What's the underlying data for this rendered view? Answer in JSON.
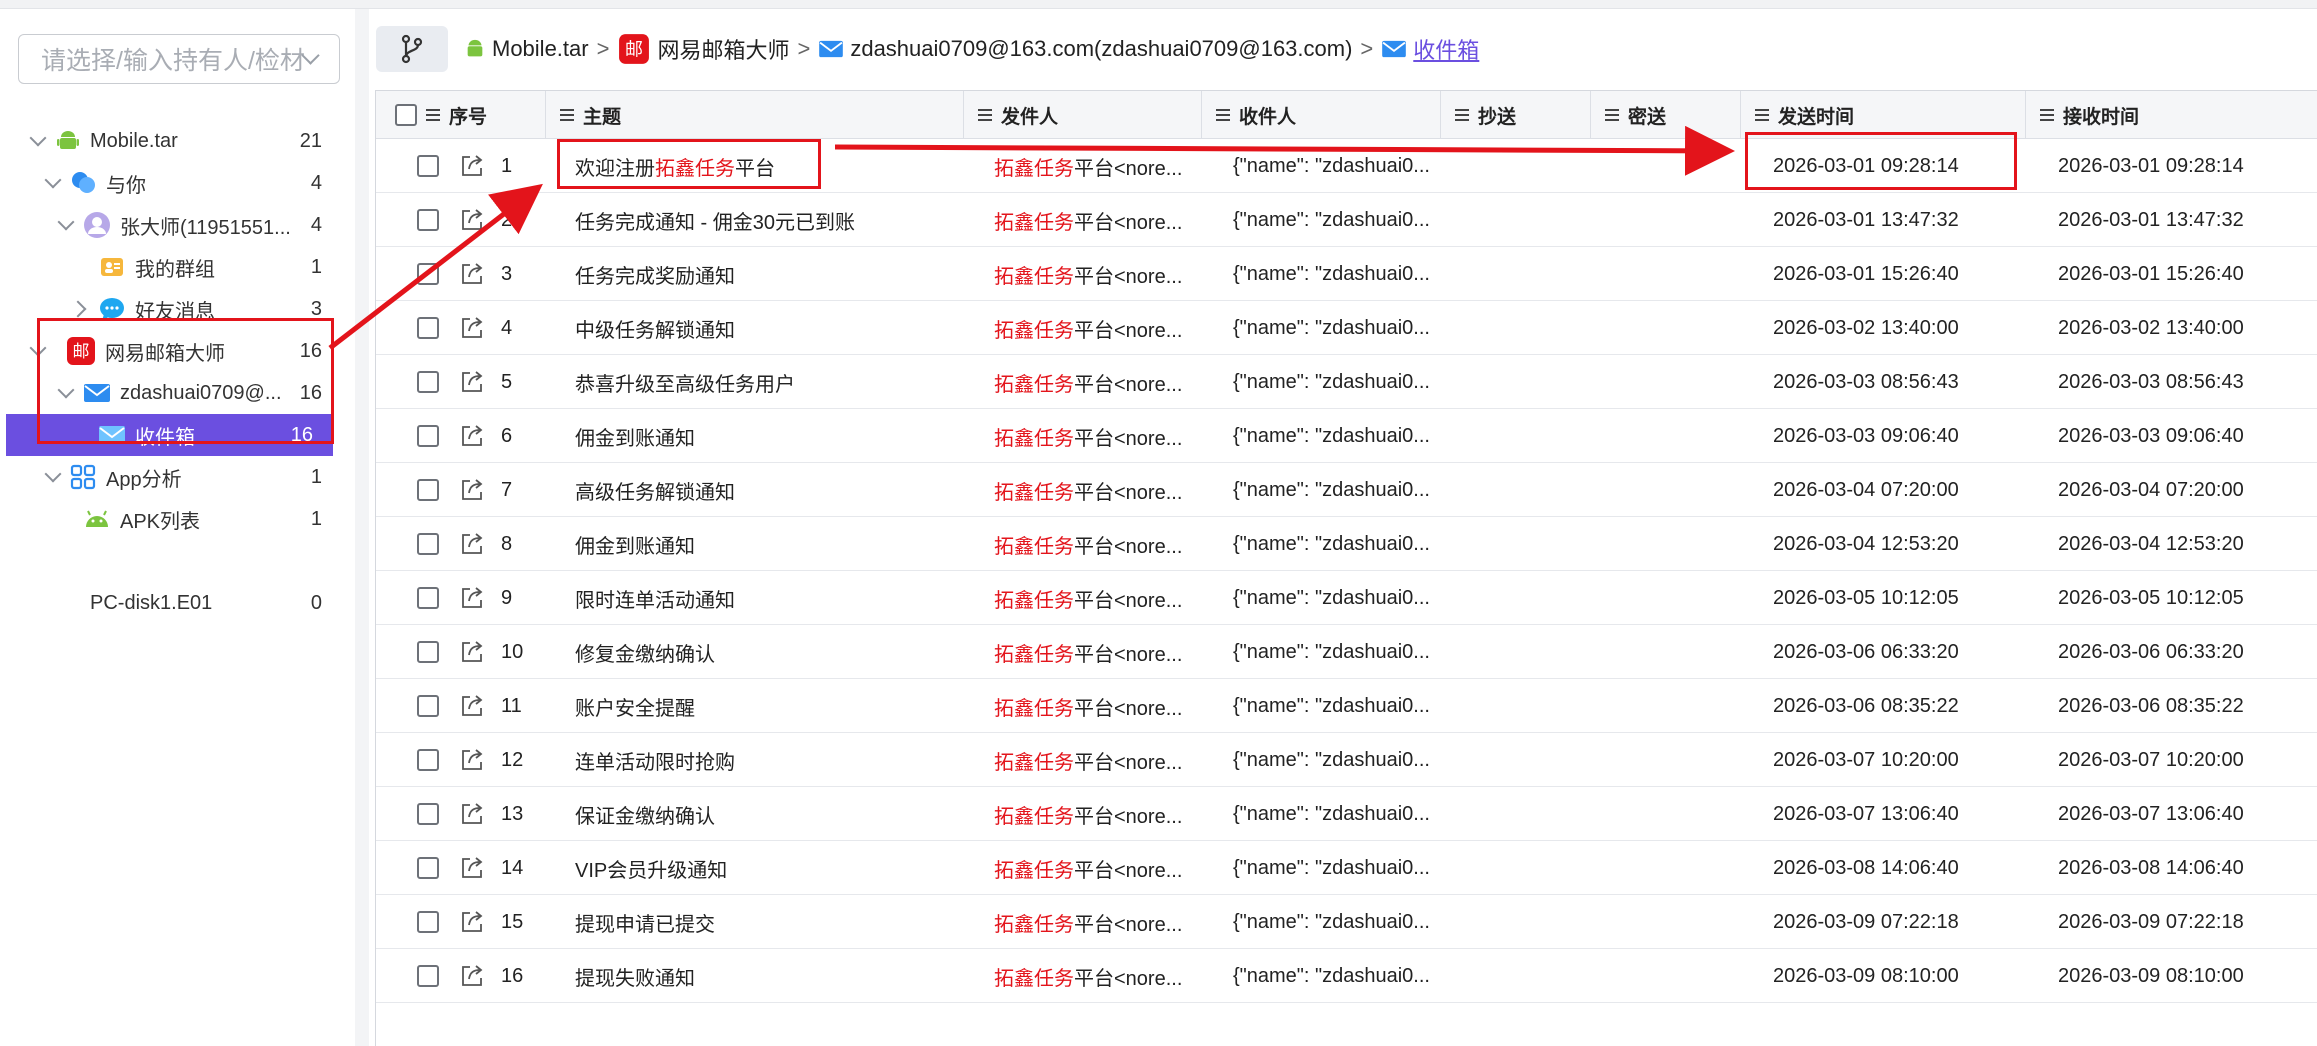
{
  "sidebar": {
    "holder_placeholder": "请选择/输入持有人/检材",
    "tree": [
      {
        "label": "Mobile.tar",
        "count": "21"
      },
      {
        "label": "与你",
        "count": "4"
      },
      {
        "label": "张大师(11951551...",
        "count": "4"
      },
      {
        "label": "我的群组",
        "count": "1"
      },
      {
        "label": "好友消息",
        "count": "3"
      },
      {
        "label": "网易邮箱大师",
        "count": "16"
      },
      {
        "label": "zdashuai0709@...",
        "count": "16"
      },
      {
        "label": "收件箱",
        "count": "16"
      },
      {
        "label": "App分析",
        "count": "1"
      },
      {
        "label": "APK列表",
        "count": "1"
      },
      {
        "label": "PC-disk1.E01",
        "count": "0"
      }
    ]
  },
  "breadcrumb": {
    "items": [
      "Mobile.tar",
      "网易邮箱大师",
      "zdashuai0709@163.com(zdashuai0709@163.com)",
      "收件箱"
    ],
    "separator": ">",
    "mail_app_badge": "邮"
  },
  "table": {
    "columns": [
      "序号",
      "主题",
      "发件人",
      "收件人",
      "抄送",
      "密送",
      "发送时间",
      "接收时间"
    ],
    "rows": [
      {
        "no": "1",
        "subject": "欢迎注册拓鑫任务平台",
        "sender_red": "拓鑫任务",
        "sender_rest": "平台<nore...",
        "recipient": "{\"name\": \"zdashuai0...",
        "sent": "2026-03-01 09:28:14",
        "received": "2026-03-01 09:28:14"
      },
      {
        "no": "2",
        "subject": "任务完成通知 - 佣金30元已到账",
        "sender_red": "拓鑫任务",
        "sender_rest": "平台<nore...",
        "recipient": "{\"name\": \"zdashuai0...",
        "sent": "2026-03-01 13:47:32",
        "received": "2026-03-01 13:47:32"
      },
      {
        "no": "3",
        "subject": "任务完成奖励通知",
        "sender_red": "拓鑫任务",
        "sender_rest": "平台<nore...",
        "recipient": "{\"name\": \"zdashuai0...",
        "sent": "2026-03-01 15:26:40",
        "received": "2026-03-01 15:26:40"
      },
      {
        "no": "4",
        "subject": "中级任务解锁通知",
        "sender_red": "拓鑫任务",
        "sender_rest": "平台<nore...",
        "recipient": "{\"name\": \"zdashuai0...",
        "sent": "2026-03-02 13:40:00",
        "received": "2026-03-02 13:40:00"
      },
      {
        "no": "5",
        "subject": "恭喜升级至高级任务用户",
        "sender_red": "拓鑫任务",
        "sender_rest": "平台<nore...",
        "recipient": "{\"name\": \"zdashuai0...",
        "sent": "2026-03-03 08:56:43",
        "received": "2026-03-03 08:56:43"
      },
      {
        "no": "6",
        "subject": "佣金到账通知",
        "sender_red": "拓鑫任务",
        "sender_rest": "平台<nore...",
        "recipient": "{\"name\": \"zdashuai0...",
        "sent": "2026-03-03 09:06:40",
        "received": "2026-03-03 09:06:40"
      },
      {
        "no": "7",
        "subject": "高级任务解锁通知",
        "sender_red": "拓鑫任务",
        "sender_rest": "平台<nore...",
        "recipient": "{\"name\": \"zdashuai0...",
        "sent": "2026-03-04 07:20:00",
        "received": "2026-03-04 07:20:00"
      },
      {
        "no": "8",
        "subject": "佣金到账通知",
        "sender_red": "拓鑫任务",
        "sender_rest": "平台<nore...",
        "recipient": "{\"name\": \"zdashuai0...",
        "sent": "2026-03-04 12:53:20",
        "received": "2026-03-04 12:53:20"
      },
      {
        "no": "9",
        "subject": "限时连单活动通知",
        "sender_red": "拓鑫任务",
        "sender_rest": "平台<nore...",
        "recipient": "{\"name\": \"zdashuai0...",
        "sent": "2026-03-05 10:12:05",
        "received": "2026-03-05 10:12:05"
      },
      {
        "no": "10",
        "subject": "修复金缴纳确认",
        "sender_red": "拓鑫任务",
        "sender_rest": "平台<nore...",
        "recipient": "{\"name\": \"zdashuai0...",
        "sent": "2026-03-06 06:33:20",
        "received": "2026-03-06 06:33:20"
      },
      {
        "no": "11",
        "subject": "账户安全提醒",
        "sender_red": "拓鑫任务",
        "sender_rest": "平台<nore...",
        "recipient": "{\"name\": \"zdashuai0...",
        "sent": "2026-03-06 08:35:22",
        "received": "2026-03-06 08:35:22"
      },
      {
        "no": "12",
        "subject": "连单活动限时抢购",
        "sender_red": "拓鑫任务",
        "sender_rest": "平台<nore...",
        "recipient": "{\"name\": \"zdashuai0...",
        "sent": "2026-03-07 10:20:00",
        "received": "2026-03-07 10:20:00"
      },
      {
        "no": "13",
        "subject": "保证金缴纳确认",
        "sender_red": "拓鑫任务",
        "sender_rest": "平台<nore...",
        "recipient": "{\"name\": \"zdashuai0...",
        "sent": "2026-03-07 13:06:40",
        "received": "2026-03-07 13:06:40"
      },
      {
        "no": "14",
        "subject": "VIP会员升级通知",
        "sender_red": "拓鑫任务",
        "sender_rest": "平台<nore...",
        "recipient": "{\"name\": \"zdashuai0...",
        "sent": "2026-03-08 14:06:40",
        "received": "2026-03-08 14:06:40"
      },
      {
        "no": "15",
        "subject": "提现申请已提交",
        "sender_red": "拓鑫任务",
        "sender_rest": "平台<nore...",
        "recipient": "{\"name\": \"zdashuai0...",
        "sent": "2026-03-09 07:22:18",
        "received": "2026-03-09 07:22:18"
      },
      {
        "no": "16",
        "subject": "提现失败通知",
        "sender_red": "拓鑫任务",
        "sender_rest": "平台<nore...",
        "recipient": "{\"name\": \"zdashuai0...",
        "sent": "2026-03-09 08:10:00",
        "received": "2026-03-09 08:10:00"
      }
    ],
    "row1_subject_parts": [
      "欢迎注册",
      "拓鑫任务",
      "平台"
    ]
  },
  "colors": {
    "accent": "#6b4fe0",
    "highlight_red": "#e3141b",
    "android_green": "#7cc43f",
    "mail_blue": "#2d8cf0"
  },
  "icons": [
    "branch-icon",
    "android-icon",
    "mail-app-icon",
    "envelope-icon",
    "chat-icon",
    "avatar-icon",
    "group-icon",
    "bubble-icon",
    "apps-grid-icon",
    "export-icon"
  ]
}
